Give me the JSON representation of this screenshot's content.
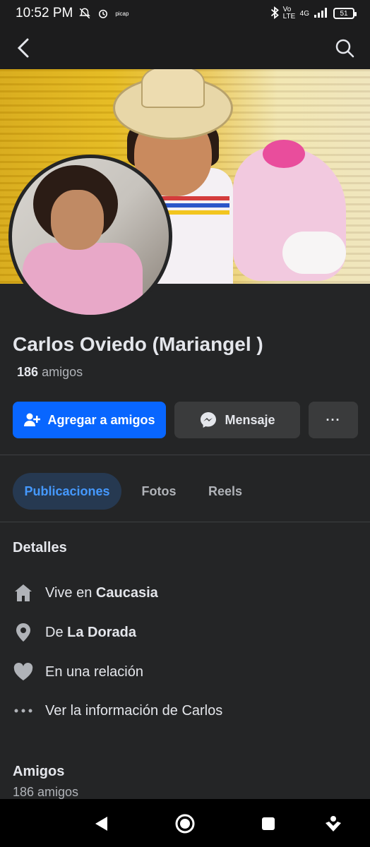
{
  "status_bar": {
    "time": "10:52 PM",
    "network_small": "picap",
    "volte": "Vo LTE",
    "network_type": "4G",
    "battery": "51"
  },
  "profile": {
    "name": "Carlos Oviedo (Mariangel )",
    "friend_count_number": "186",
    "friend_count_label": "amigos"
  },
  "actions": {
    "add_friend": "Agregar a amigos",
    "message": "Mensaje",
    "more": "···"
  },
  "tabs": [
    {
      "label": "Publicaciones",
      "active": true
    },
    {
      "label": "Fotos",
      "active": false
    },
    {
      "label": "Reels",
      "active": false
    }
  ],
  "details": {
    "title": "Detalles",
    "lives_in_prefix": "Vive en",
    "lives_in_place": "Caucasia",
    "from_prefix": "De",
    "from_place": "La Dorada",
    "relationship": "En una relación",
    "see_info": "Ver la información de Carlos"
  },
  "friends_section": {
    "title": "Amigos",
    "count": "186 amigos"
  },
  "colors": {
    "primary_blue": "#0866ff",
    "active_tab_bg": "#263951",
    "active_tab_text": "#4599ff",
    "background": "#242526"
  }
}
